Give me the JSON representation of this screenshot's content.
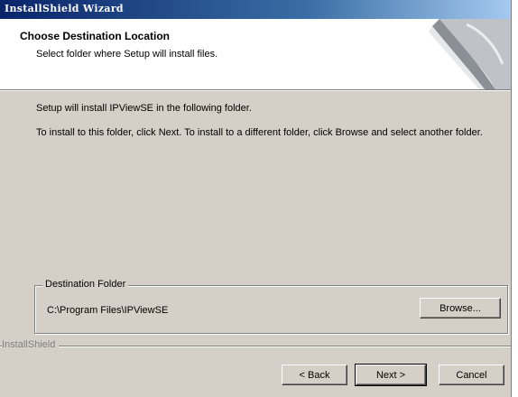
{
  "window": {
    "title": "InstallShield Wizard"
  },
  "header": {
    "title": "Choose Destination Location",
    "subtitle": "Select folder where Setup will install files."
  },
  "body": {
    "line1": "Setup will install IPViewSE in the following folder.",
    "line2": "To install to this folder, click Next. To install to a different folder, click Browse and select another folder."
  },
  "destination": {
    "group_label": "Destination Folder",
    "path": "C:\\Program Files\\IPViewSE",
    "browse_label": "Browse..."
  },
  "footer": {
    "brand": "InstallShield",
    "back_label": "< Back",
    "next_label": "Next >",
    "cancel_label": "Cancel"
  },
  "colors": {
    "dialog_face": "#d4d0c8",
    "title_bar": "#0a246a",
    "header_bg": "#ffffff"
  }
}
